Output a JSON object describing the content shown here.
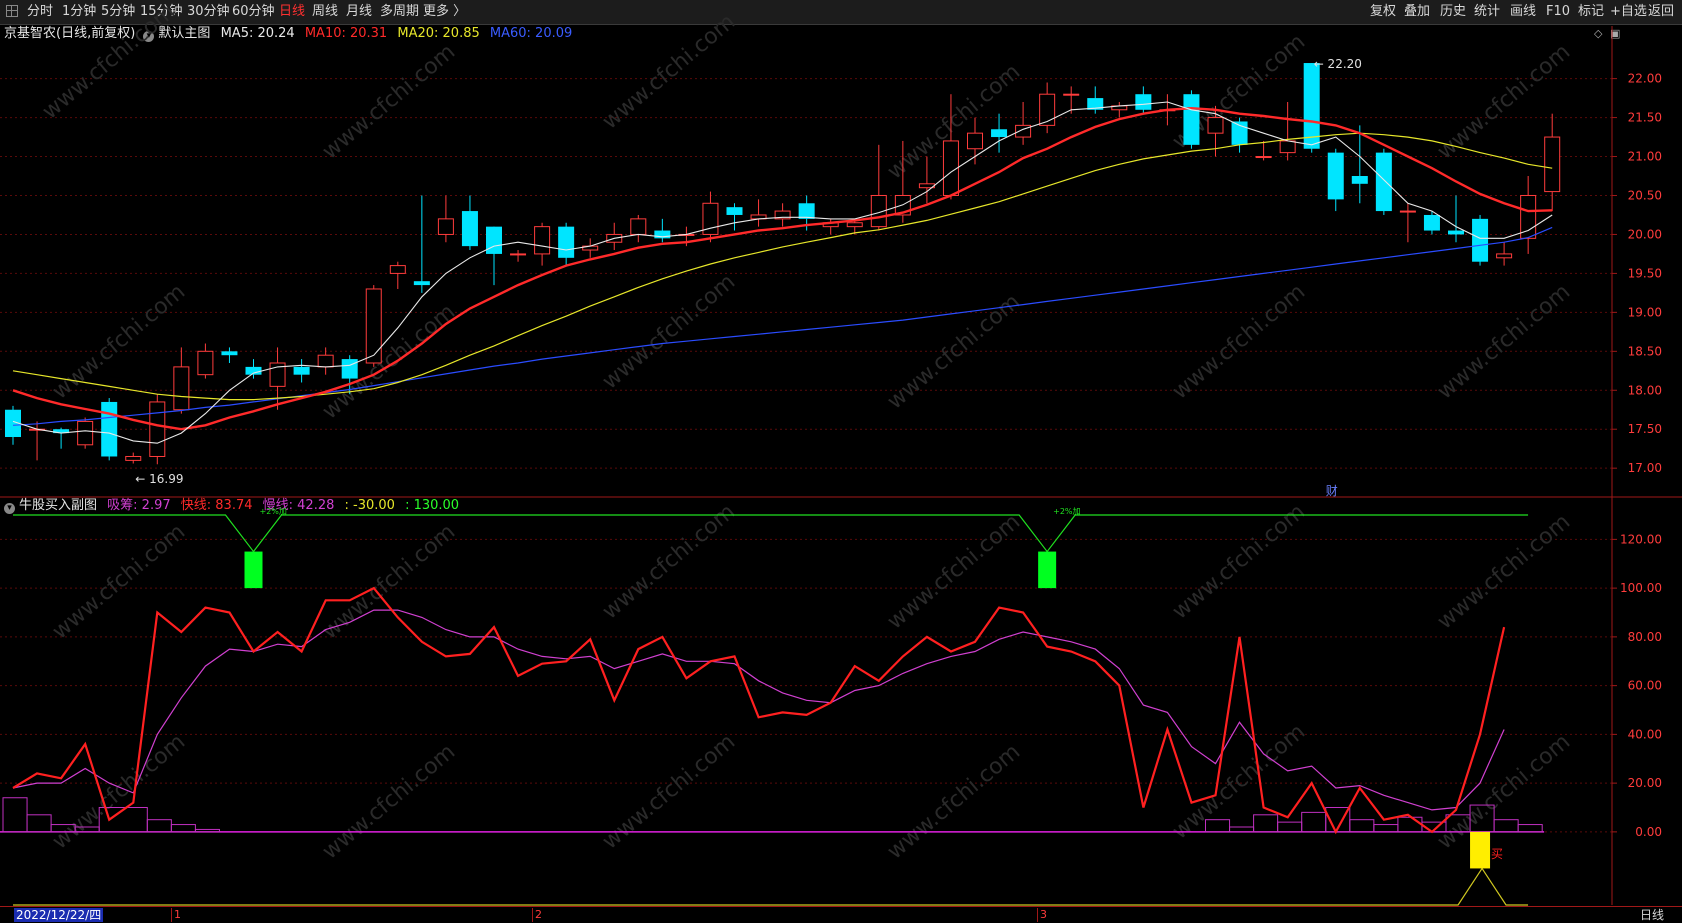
{
  "toolbar": {
    "left": [
      {
        "id": "t-fenshi",
        "label": "分时",
        "x": 27
      },
      {
        "id": "t-1min",
        "label": "1分钟",
        "x": 62
      },
      {
        "id": "t-5min",
        "label": "5分钟",
        "x": 101
      },
      {
        "id": "t-15min",
        "label": "15分钟",
        "x": 140
      },
      {
        "id": "t-30min",
        "label": "30分钟",
        "x": 187
      },
      {
        "id": "t-60min",
        "label": "60分钟",
        "x": 232
      },
      {
        "id": "t-day",
        "label": "日线",
        "x": 279,
        "active": true
      },
      {
        "id": "t-week",
        "label": "周线",
        "x": 312
      },
      {
        "id": "t-month",
        "label": "月线",
        "x": 346
      },
      {
        "id": "t-multi",
        "label": "多周期",
        "x": 380
      },
      {
        "id": "t-more",
        "label": "更多 〉",
        "x": 423
      }
    ],
    "right": [
      {
        "id": "t-fuquan",
        "label": "复权",
        "x": 1370
      },
      {
        "id": "t-diejia",
        "label": "叠加",
        "x": 1404
      },
      {
        "id": "t-lishi",
        "label": "历史",
        "x": 1440
      },
      {
        "id": "t-tongji",
        "label": "统计",
        "x": 1474
      },
      {
        "id": "t-huaxian",
        "label": "画线",
        "x": 1510
      },
      {
        "id": "t-f10",
        "label": "F10",
        "x": 1546
      },
      {
        "id": "t-biaoji",
        "label": "标记",
        "x": 1578
      },
      {
        "id": "t-zixuan",
        "label": "+自选",
        "x": 1610
      },
      {
        "id": "t-fanhui",
        "label": "返回",
        "x": 1648
      }
    ]
  },
  "main_header": {
    "stock": "京基智农(日线,前复权)",
    "template": "默认主图",
    "ma5": "MA5: 20.24",
    "ma10": "MA10: 20.31",
    "ma20": "MA20: 20.85",
    "ma60": "MA60: 20.09"
  },
  "sub_header": {
    "name": "牛股买入副图",
    "xichou": "吸筹: 2.97",
    "kuaixian": "快线: 83.74",
    "manxian": "慢线: 42.28",
    "v1": ": -30.00",
    "v2": ": 130.00"
  },
  "colors": {
    "up": "#ff3c3c",
    "down": "#00e5ff",
    "ma5": "#e8e8e8",
    "ma10": "#ff2a2a",
    "ma20": "#e6e62a",
    "ma60": "#2a4cff",
    "fast": "#ff2020",
    "slow": "#d040d0",
    "grid": "#5a0a0a",
    "axis": "#a01818"
  },
  "watermark": "www.cfchi.com",
  "bottom": {
    "date": "2022/12/22/四",
    "period": "日线",
    "month_ticks": [
      "1",
      "2",
      "3"
    ]
  },
  "chart_data": [
    {
      "type": "candlestick",
      "id": "main",
      "y_ticks": [
        "22.00",
        "21.50",
        "21.00",
        "20.50",
        "20.00",
        "19.50",
        "19.00",
        "18.50",
        "18.00",
        "17.50",
        "17.00"
      ],
      "ylim": [
        16.63,
        22.47
      ],
      "candles": [
        [
          17.75,
          17.4,
          17.8,
          17.3
        ],
        [
          17.5,
          17.5,
          17.6,
          17.1
        ],
        [
          17.5,
          17.45,
          17.52,
          17.25
        ],
        [
          17.3,
          17.6,
          17.65,
          17.25
        ],
        [
          17.85,
          17.15,
          17.9,
          17.1
        ],
        [
          17.1,
          17.15,
          17.2,
          17.06
        ],
        [
          17.15,
          17.85,
          17.95,
          17.05
        ],
        [
          17.75,
          18.3,
          18.55,
          17.7
        ],
        [
          18.2,
          18.5,
          18.6,
          18.15
        ],
        [
          18.5,
          18.45,
          18.55,
          18.35
        ],
        [
          18.3,
          18.2,
          18.4,
          18.15
        ],
        [
          18.05,
          18.35,
          18.55,
          17.75
        ],
        [
          18.3,
          18.2,
          18.4,
          18.1
        ],
        [
          18.3,
          18.45,
          18.55,
          18.2
        ],
        [
          18.4,
          18.15,
          18.45,
          17.95
        ],
        [
          18.35,
          19.3,
          19.35,
          18.3
        ],
        [
          19.5,
          19.6,
          19.65,
          19.3
        ],
        [
          19.4,
          19.35,
          20.5,
          19.25
        ],
        [
          20.0,
          20.2,
          20.5,
          19.9
        ],
        [
          20.3,
          19.85,
          20.5,
          19.8
        ],
        [
          20.1,
          19.75,
          20.1,
          19.35
        ],
        [
          19.75,
          19.75,
          19.8,
          19.65
        ],
        [
          19.75,
          20.1,
          20.15,
          19.6
        ],
        [
          20.1,
          19.7,
          20.15,
          19.6
        ],
        [
          19.8,
          19.85,
          19.95,
          19.7
        ],
        [
          19.9,
          20.0,
          20.15,
          19.8
        ],
        [
          20.0,
          20.2,
          20.25,
          19.9
        ],
        [
          20.05,
          19.95,
          20.2,
          19.9
        ],
        [
          20.0,
          20.0,
          20.1,
          19.85
        ],
        [
          20.0,
          20.4,
          20.55,
          19.9
        ],
        [
          20.35,
          20.25,
          20.4,
          20.05
        ],
        [
          20.2,
          20.25,
          20.45,
          20.1
        ],
        [
          20.2,
          20.3,
          20.4,
          20.1
        ],
        [
          20.4,
          20.2,
          20.5,
          20.05
        ],
        [
          20.1,
          20.15,
          20.2,
          20.0
        ],
        [
          20.1,
          20.15,
          20.2,
          20.0
        ],
        [
          20.1,
          20.5,
          21.15,
          20.05
        ],
        [
          20.25,
          20.5,
          21.2,
          20.15
        ],
        [
          20.6,
          20.65,
          21.0,
          20.4
        ],
        [
          20.5,
          21.2,
          21.8,
          20.45
        ],
        [
          21.1,
          21.3,
          21.5,
          20.9
        ],
        [
          21.35,
          21.25,
          21.55,
          21.05
        ],
        [
          21.25,
          21.4,
          21.7,
          21.15
        ],
        [
          21.4,
          21.8,
          21.95,
          21.3
        ],
        [
          21.8,
          21.8,
          21.9,
          21.55
        ],
        [
          21.75,
          21.6,
          21.9,
          21.55
        ],
        [
          21.6,
          21.65,
          21.7,
          21.5
        ],
        [
          21.8,
          21.6,
          21.9,
          21.55
        ],
        [
          21.6,
          21.6,
          21.8,
          21.4
        ],
        [
          21.8,
          21.15,
          21.85,
          21.1
        ],
        [
          21.3,
          21.5,
          21.65,
          21.0
        ],
        [
          21.45,
          21.15,
          21.5,
          21.05
        ],
        [
          21.0,
          21.0,
          21.2,
          20.95
        ],
        [
          21.05,
          21.2,
          21.7,
          20.95
        ],
        [
          22.2,
          21.1,
          22.2,
          21.05
        ],
        [
          21.05,
          20.45,
          21.1,
          20.3
        ],
        [
          20.75,
          20.65,
          21.4,
          20.4
        ],
        [
          21.05,
          20.3,
          21.1,
          20.25
        ],
        [
          20.3,
          20.3,
          20.4,
          19.9
        ],
        [
          20.25,
          20.05,
          20.3,
          20.0
        ],
        [
          20.05,
          20.0,
          20.5,
          19.9
        ],
        [
          20.2,
          19.65,
          20.25,
          19.6
        ],
        [
          19.7,
          19.75,
          19.9,
          19.6
        ],
        [
          19.95,
          20.5,
          20.75,
          19.75
        ],
        [
          20.55,
          21.25,
          21.55,
          20.3
        ]
      ],
      "ma5": [
        17.6,
        17.5,
        17.45,
        17.48,
        17.45,
        17.35,
        17.32,
        17.45,
        17.7,
        18.0,
        18.22,
        18.3,
        18.32,
        18.3,
        18.32,
        18.45,
        18.8,
        19.2,
        19.5,
        19.7,
        19.85,
        19.9,
        19.85,
        19.8,
        19.85,
        19.95,
        20.0,
        19.97,
        20.0,
        20.08,
        20.15,
        20.2,
        20.22,
        20.22,
        20.2,
        20.2,
        20.28,
        20.38,
        20.55,
        20.8,
        21.0,
        21.2,
        21.35,
        21.45,
        21.6,
        21.62,
        21.65,
        21.67,
        21.7,
        21.6,
        21.55,
        21.4,
        21.3,
        21.2,
        21.15,
        21.25,
        21.0,
        20.7,
        20.4,
        20.3,
        20.1,
        19.95,
        19.95,
        20.05,
        20.25
      ],
      "ma10": [
        18.0,
        17.9,
        17.82,
        17.76,
        17.7,
        17.62,
        17.55,
        17.5,
        17.55,
        17.65,
        17.73,
        17.82,
        17.9,
        17.98,
        18.08,
        18.2,
        18.38,
        18.6,
        18.85,
        19.05,
        19.2,
        19.35,
        19.48,
        19.6,
        19.68,
        19.75,
        19.83,
        19.88,
        19.9,
        19.95,
        20.0,
        20.05,
        20.08,
        20.12,
        20.15,
        20.18,
        20.22,
        20.28,
        20.38,
        20.5,
        20.65,
        20.8,
        20.98,
        21.1,
        21.25,
        21.38,
        21.48,
        21.55,
        21.6,
        21.62,
        21.6,
        21.55,
        21.52,
        21.48,
        21.45,
        21.4,
        21.3,
        21.15,
        21.0,
        20.85,
        20.68,
        20.52,
        20.4,
        20.3,
        20.31
      ],
      "ma20": [
        18.25,
        18.2,
        18.15,
        18.1,
        18.05,
        18.0,
        17.95,
        17.92,
        17.9,
        17.88,
        17.88,
        17.9,
        17.92,
        17.95,
        17.98,
        18.02,
        18.1,
        18.2,
        18.32,
        18.45,
        18.57,
        18.7,
        18.83,
        18.95,
        19.08,
        19.2,
        19.32,
        19.43,
        19.53,
        19.62,
        19.7,
        19.77,
        19.84,
        19.9,
        19.96,
        20.02,
        20.06,
        20.12,
        20.18,
        20.26,
        20.34,
        20.42,
        20.52,
        20.62,
        20.72,
        20.82,
        20.9,
        20.97,
        21.02,
        21.07,
        21.1,
        21.15,
        21.18,
        21.22,
        21.25,
        21.28,
        21.3,
        21.28,
        21.25,
        21.2,
        21.13,
        21.05,
        20.98,
        20.9,
        20.85
      ],
      "ma60": [
        17.55,
        17.57,
        17.6,
        17.62,
        17.65,
        17.68,
        17.71,
        17.74,
        17.78,
        17.81,
        17.85,
        17.89,
        17.93,
        17.97,
        18.01,
        18.06,
        18.11,
        18.16,
        18.21,
        18.26,
        18.31,
        18.35,
        18.4,
        18.44,
        18.48,
        18.52,
        18.56,
        18.6,
        18.63,
        18.66,
        18.69,
        18.72,
        18.75,
        18.78,
        18.81,
        18.84,
        18.87,
        18.9,
        18.94,
        18.98,
        19.02,
        19.06,
        19.1,
        19.14,
        19.18,
        19.22,
        19.26,
        19.3,
        19.34,
        19.38,
        19.42,
        19.46,
        19.5,
        19.54,
        19.58,
        19.62,
        19.66,
        19.7,
        19.74,
        19.78,
        19.82,
        19.86,
        19.9,
        19.96,
        20.09
      ],
      "annotations": [
        {
          "text": "← 16.99",
          "value": 16.99,
          "index": 5
        },
        {
          "text": "← 22.20",
          "value": 22.2,
          "index": 54
        },
        {
          "text": "财",
          "index": 54
        }
      ]
    },
    {
      "type": "line",
      "id": "sub",
      "y_ticks": [
        "120.00",
        "100.00",
        "80.00",
        "60.00",
        "40.00",
        "20.00",
        "0.00"
      ],
      "ylim": [
        -30,
        130
      ],
      "fast": [
        18,
        24,
        22,
        36,
        5,
        12,
        90,
        82,
        92,
        90,
        74,
        82,
        74,
        95,
        95,
        100,
        88,
        78,
        72,
        73,
        84,
        64,
        69,
        70,
        79,
        54,
        75,
        80,
        63,
        70,
        72,
        47,
        49,
        48,
        53,
        68,
        62,
        72,
        80,
        74,
        78,
        92,
        90,
        76,
        74,
        70,
        60,
        10,
        42,
        12,
        15,
        80,
        10,
        6,
        20,
        0,
        18,
        5,
        7,
        0,
        9,
        40,
        84
      ],
      "slow": [
        18,
        20,
        20,
        26,
        20,
        16,
        40,
        55,
        68,
        75,
        74,
        77,
        76,
        83,
        86,
        91,
        91,
        88,
        83,
        80,
        80,
        75,
        72,
        71,
        72,
        67,
        70,
        73,
        70,
        70,
        69,
        62,
        57,
        54,
        53,
        58,
        60,
        65,
        69,
        72,
        74,
        79,
        82,
        80,
        78,
        75,
        67,
        52,
        49,
        35,
        28,
        45,
        32,
        25,
        27,
        18,
        19,
        15,
        12,
        9,
        10,
        20,
        42
      ],
      "fast_index_offset": 0,
      "slow_index_offset": 0,
      "line130_dips": [
        {
          "index": 10
        },
        {
          "index": 43
        }
      ],
      "green_bars": [
        {
          "index": 10,
          "from": 100,
          "to": 115
        },
        {
          "index": 43,
          "from": 100,
          "to": 115
        }
      ],
      "green_tags": [
        "+2%加",
        "+2%加"
      ],
      "baseline_minus30": [
        {
          "index": 61,
          "peak": -15
        }
      ],
      "buy_signal": {
        "index": 61,
        "label": "买",
        "from": -15,
        "to": 0
      },
      "xichou_boxes": [
        {
          "i0": 0,
          "i1": 1,
          "v": 14
        },
        {
          "i0": 1,
          "i1": 2,
          "v": 7
        },
        {
          "i0": 2,
          "i1": 3,
          "v": 3
        },
        {
          "i0": 3,
          "i1": 4,
          "v": 2
        },
        {
          "i0": 4,
          "i1": 6,
          "v": 10
        },
        {
          "i0": 6,
          "i1": 7,
          "v": 5
        },
        {
          "i0": 7,
          "i1": 8,
          "v": 3
        },
        {
          "i0": 8,
          "i1": 9,
          "v": 1
        },
        {
          "i0": 50,
          "i1": 51,
          "v": 5
        },
        {
          "i0": 51,
          "i1": 52,
          "v": 2
        },
        {
          "i0": 52,
          "i1": 53,
          "v": 7
        },
        {
          "i0": 53,
          "i1": 54,
          "v": 4
        },
        {
          "i0": 54,
          "i1": 55,
          "v": 8
        },
        {
          "i0": 55,
          "i1": 56,
          "v": 10
        },
        {
          "i0": 56,
          "i1": 57,
          "v": 5
        },
        {
          "i0": 57,
          "i1": 58,
          "v": 3
        },
        {
          "i0": 58,
          "i1": 59,
          "v": 6
        },
        {
          "i0": 59,
          "i1": 60,
          "v": 4
        },
        {
          "i0": 60,
          "i1": 61,
          "v": 7
        },
        {
          "i0": 61,
          "i1": 62,
          "v": 11
        },
        {
          "i0": 62,
          "i1": 63,
          "v": 5
        },
        {
          "i0": 63,
          "i1": 64,
          "v": 3
        }
      ]
    }
  ]
}
